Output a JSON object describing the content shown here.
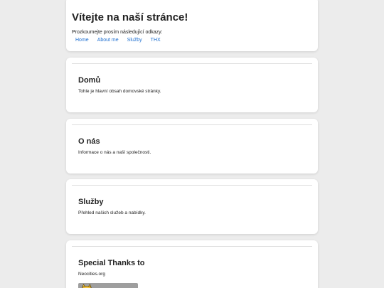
{
  "header": {
    "title": "Vítejte na naší stránce!",
    "subtitle": "Prozkoumejte prosím následující odkazy:",
    "nav": [
      {
        "label": "Home"
      },
      {
        "label": "About me"
      },
      {
        "label": "Služby"
      },
      {
        "label": "THX"
      }
    ]
  },
  "sections": {
    "home": {
      "title": "Domů",
      "text": "Tohle je hlavní obsah domovské stránky."
    },
    "about": {
      "title": "O nás",
      "text": "Informace o nás a naší společnosti."
    },
    "services": {
      "title": "Služby",
      "text": "Přehled našich služeb a nabídky."
    },
    "thanks": {
      "title": "Special Thanks to",
      "text": "Neocities.org",
      "badge_icon": "neocities-cat-badge"
    }
  },
  "colors": {
    "background": "#ececec",
    "card": "#ffffff",
    "link": "#1e6fd0"
  }
}
